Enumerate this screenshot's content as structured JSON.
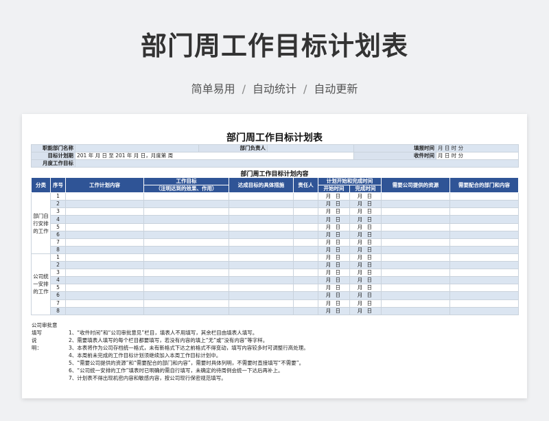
{
  "hero": {
    "title": "部门周工作目标计划表",
    "tags": [
      "简单易用",
      "自动统计",
      "自动更新"
    ],
    "separator": "/"
  },
  "sheet": {
    "title": "部门周工作目标计划表",
    "header": {
      "dept_name_label": "职能部门名称",
      "dept_head_label": "部门负责人",
      "report_time_label": "填报时间",
      "report_time_value": "月  日  时  分",
      "plan_period_label": "目标计划期",
      "plan_period_value": "201  年  月  日 至 201 年  月  日，月度第  周",
      "receive_time_label": "收件时间",
      "receive_time_value": "月  日  时  分",
      "monthly_goal_label": "月度工作目标"
    },
    "section_title": "部门周工作目标计划内容",
    "columns": {
      "category": "分类",
      "seq": "序号",
      "work_content": "工作计划内容",
      "work_goal": "工作目标",
      "work_goal_note": "（注明达到的效果、作用）",
      "measures": "达成目标的具体措施",
      "owner": "责任人",
      "time_group": "计划开始和完成时间",
      "start_time": "开始时间",
      "end_time": "完成时间",
      "resources": "需要公司提供的资源",
      "coop": "需要配合的部门和内容"
    },
    "date_placeholder": "月  日",
    "groups": [
      {
        "category": "部门自行安排的工作",
        "rows": [
          "1",
          "2",
          "3",
          "4",
          "5",
          "6",
          "7",
          "8"
        ]
      },
      {
        "category": "公司统一安排的工作",
        "rows": [
          "1",
          "2",
          "3",
          "4",
          "5",
          "6",
          "7",
          "8"
        ]
      }
    ],
    "approval_label": "公司审批意",
    "notes_label": "填写说明：",
    "notes": [
      "1、“收件时间”和“公司审批意见”栏目，填表人不用填写，其余栏目由填表人填写。",
      "2、需要填表人填写的每个栏目都要填写，若没有内容的填上“无”或“没有内容”等字样。",
      "3、本表将作为公司存档统一格式，未有新格式下达之前格式不得变动，填写内容较多时可调整行高处理。",
      "4、本周前未完成的工作目标计划须继续加入本周工作目标计划中。",
      "5、“需要公司提供的资源”和“需要配合的部门和内容”，需要时具体列明，不需要时直接填写“不需要”。",
      "6、“公司统一安排的工作”填表时已明确的需自行填写，未确定的待周例会统一下达后再补上。",
      "7、计划表不得出现机密内容和敏感内容，按公司现行保密规范填写。"
    ]
  }
}
